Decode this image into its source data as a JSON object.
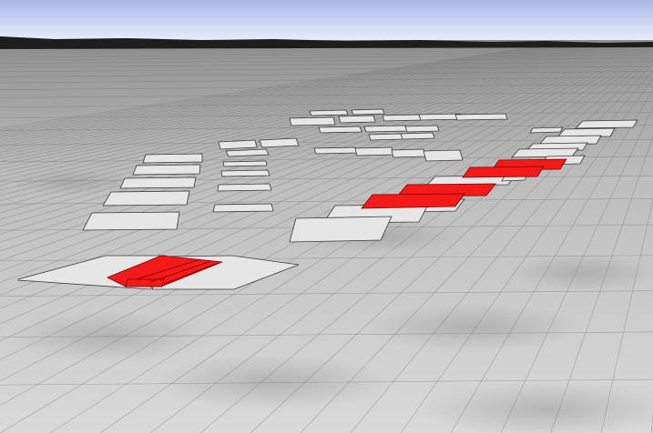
{
  "scene": {
    "colors": {
      "sky_top": "#a9b9e8",
      "sky_bottom": "#eef1fb",
      "terrain_horizon": "#1e1e1e",
      "ground_far": "#8f8f8f",
      "ground_near": "#d9d9d9",
      "grid_line": "#7a7a7a",
      "cell_fill": "#e6e6e6",
      "cell_stroke": "#3a3a3a",
      "highlight_fill": "#f41a1a",
      "highlight_stroke": "#7a0000"
    },
    "highlighted_cells_count": 6
  }
}
